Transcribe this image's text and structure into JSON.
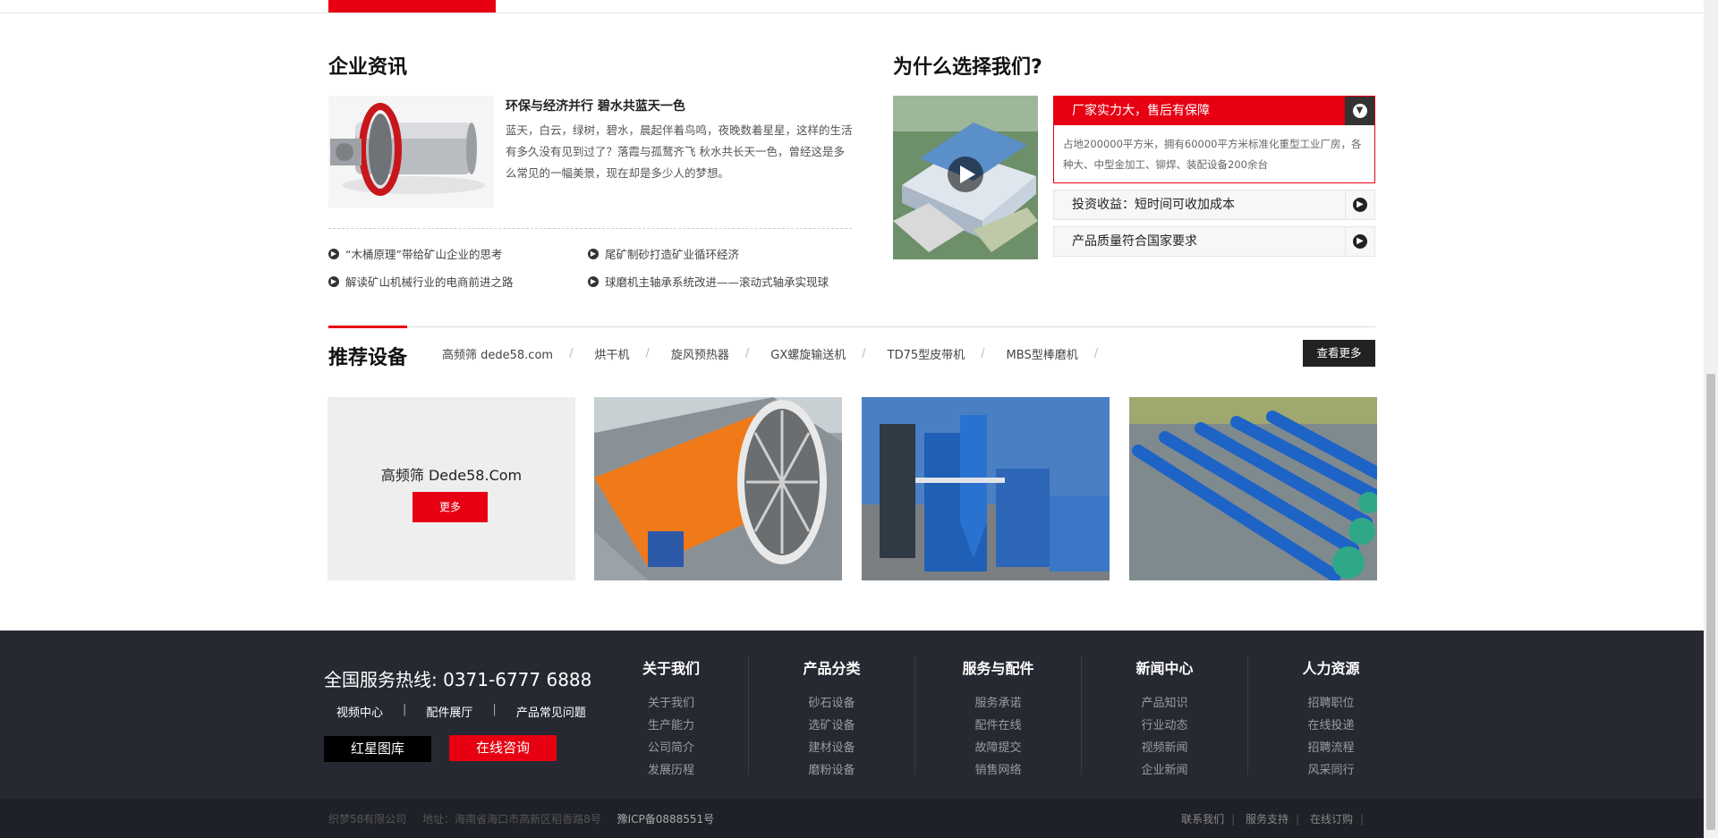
{
  "news": {
    "title": "企业资讯",
    "featured_title": "环保与经济并行 碧水共蓝天一色",
    "featured_desc": "蓝天，白云，绿树，碧水，晨起伴着鸟鸣，夜晚数着星星，这样的生活有多久没有见到过了？落霞与孤鹜齐飞 秋水共长天一色，曾经这是多么常见的一幅美景，现在却是多少人的梦想。",
    "items": [
      "“木桶原理”带给矿山企业的思考",
      "尾矿制砂打造矿业循环经济",
      "解读矿山机械行业的电商前进之路",
      "球磨机主轴承系统改进——滚动式轴承实现球"
    ]
  },
  "why": {
    "title": "为什么选择我们?",
    "items": [
      {
        "label": "厂家实力大，售后有保障",
        "body": "占地200000平方米，拥有60000平方米标准化重型工业厂房，各种大、中型金加工、铆焊、装配设备200余台"
      },
      {
        "label": "投资收益：短时间可收加成本"
      },
      {
        "label": "产品质量符合国家要求"
      }
    ]
  },
  "recommend": {
    "title": "推荐设备",
    "tabs": [
      "高频筛 dede58.com",
      "烘干机",
      "旋风预热器",
      "GX螺旋输送机",
      "TD75型皮带机",
      "MBS型棒磨机"
    ],
    "more": "查看更多",
    "first_product": {
      "name": "高频筛 Dede58.Com",
      "button": "更多"
    }
  },
  "footer": {
    "hotline_label": "全国服务热线:",
    "hotline_number": "0371-6777 6888",
    "links": [
      "视频中心",
      "配件展厅",
      "产品常见问题"
    ],
    "btn_gallery": "红星图库",
    "btn_consult": "在线咨询",
    "columns": [
      {
        "title": "关于我们",
        "links": [
          "关于我们",
          "生产能力",
          "公司简介",
          "发展历程"
        ]
      },
      {
        "title": "产品分类",
        "links": [
          "砂石设备",
          "选矿设备",
          "建材设备",
          "磨粉设备"
        ]
      },
      {
        "title": "服务与配件",
        "links": [
          "服务承诺",
          "配件在线",
          "故障提交",
          "销售网络"
        ]
      },
      {
        "title": "新闻中心",
        "links": [
          "产品知识",
          "行业动态",
          "视频新闻",
          "企业新闻"
        ]
      },
      {
        "title": "人力资源",
        "links": [
          "招聘职位",
          "在线投递",
          "招聘流程",
          "风采同行"
        ]
      }
    ],
    "company": "织梦58有限公司",
    "address": "地址：海南省海口市高新区稻香路8号",
    "icp": "豫ICP备0888551号",
    "bottom_links": [
      "联系我们",
      "服务支持",
      "在线订购"
    ]
  },
  "colors": {
    "accent": "#e60012",
    "footer_bg": "#262932",
    "footer_bottom": "#1f2128"
  }
}
